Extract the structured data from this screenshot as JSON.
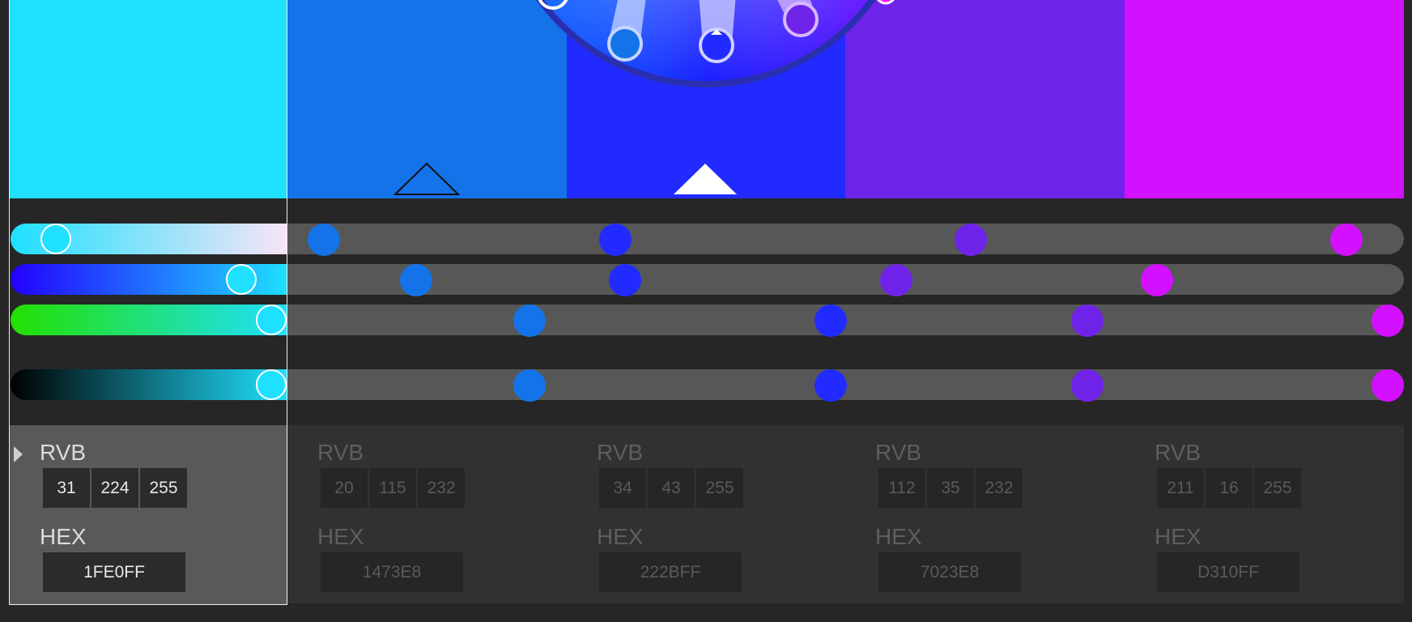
{
  "swatches": [
    {
      "color": "#1fe0ff",
      "selected": true
    },
    {
      "color": "#1473e8",
      "selected": false
    },
    {
      "color": "#222bff",
      "selected": false
    },
    {
      "color": "#7023e8",
      "selected": false
    },
    {
      "color": "#d310ff",
      "selected": false
    }
  ],
  "wheel": {
    "pointer_colors": [
      "#1473e8",
      "#222bff",
      "#7023e8"
    ]
  },
  "sliders": {
    "row1": {
      "gradient_from": "#1fe0ff",
      "gradient_to": "#f8e4f8",
      "active_color": "#1fe0ff",
      "dot_colors": [
        "#1473e8",
        "#222bff",
        "#7023e8",
        "#d310ff"
      ]
    },
    "row2": {
      "gradient_from": "#2200ff",
      "gradient_to": "#1fe0ff",
      "active_color": "#1fe0ff",
      "dot_colors": [
        "#1473e8",
        "#222bff",
        "#7023e8",
        "#d310ff"
      ]
    },
    "row3": {
      "gradient_from": "#22e000",
      "gradient_to": "#1fe0ff",
      "active_color": "#1fe0ff",
      "dot_colors": [
        "#1473e8",
        "#222bff",
        "#7023e8",
        "#d310ff"
      ]
    },
    "row4": {
      "gradient_from": "#000000",
      "gradient_to": "#1fe0ff",
      "active_color": "#1fe0ff",
      "dot_colors": [
        "#1473e8",
        "#222bff",
        "#7023e8",
        "#d310ff"
      ]
    }
  },
  "panels": [
    {
      "rvb_label": "RVB",
      "r": "31",
      "g": "224",
      "b": "255",
      "hex_label": "HEX",
      "hex": "1FE0FF",
      "active": true
    },
    {
      "rvb_label": "RVB",
      "r": "20",
      "g": "115",
      "b": "232",
      "hex_label": "HEX",
      "hex": "1473E8",
      "active": false
    },
    {
      "rvb_label": "RVB",
      "r": "34",
      "g": "43",
      "b": "255",
      "hex_label": "HEX",
      "hex": "222BFF",
      "active": false
    },
    {
      "rvb_label": "RVB",
      "r": "112",
      "g": "35",
      "b": "232",
      "hex_label": "HEX",
      "hex": "7023E8",
      "active": false
    },
    {
      "rvb_label": "RVB",
      "r": "211",
      "g": "16",
      "b": "255",
      "hex_label": "HEX",
      "hex": "D310FF",
      "active": false
    }
  ]
}
